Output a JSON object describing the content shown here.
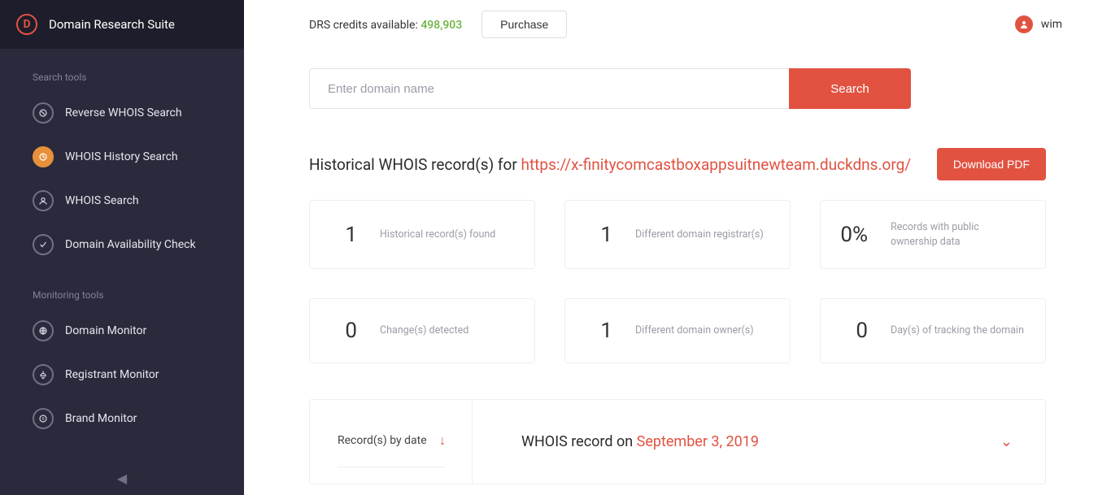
{
  "brand": {
    "name": "Domain Research Suite",
    "logo_letter": "D"
  },
  "sidebar": {
    "section_search": "Search tools",
    "section_monitoring": "Monitoring tools",
    "search_items": [
      {
        "label": "Reverse WHOIS Search",
        "icon": "reverse-icon"
      },
      {
        "label": "WHOIS History Search",
        "icon": "history-icon"
      },
      {
        "label": "WHOIS Search",
        "icon": "whois-icon"
      },
      {
        "label": "Domain Availability Check",
        "icon": "availability-icon"
      }
    ],
    "monitor_items": [
      {
        "label": "Domain Monitor",
        "icon": "domain-monitor-icon"
      },
      {
        "label": "Registrant Monitor",
        "icon": "registrant-monitor-icon"
      },
      {
        "label": "Brand Monitor",
        "icon": "brand-monitor-icon"
      }
    ]
  },
  "topbar": {
    "credits_label": "DRS credits available: ",
    "credits_value": "498,903",
    "purchase_label": "Purchase",
    "user_name": "wim"
  },
  "search": {
    "placeholder": "Enter domain name",
    "button_label": "Search"
  },
  "results": {
    "title_prefix": "Historical WHOIS record(s) for ",
    "url": "https://x-finitycomcastboxappsuitnewteam.duckdns.org/",
    "download_label": "Download PDF"
  },
  "stats": [
    {
      "value": "1",
      "label": "Historical record(s) found"
    },
    {
      "value": "1",
      "label": "Different domain registrar(s)"
    },
    {
      "value": "0%",
      "label": "Records with public ownership data"
    },
    {
      "value": "0",
      "label": "Change(s) detected"
    },
    {
      "value": "1",
      "label": "Different domain owner(s)"
    },
    {
      "value": "0",
      "label": "Day(s) of tracking the domain"
    }
  ],
  "records": {
    "by_date_label": "Record(s) by date",
    "row_prefix": "WHOIS record on ",
    "row_date": "September 3, 2019"
  }
}
